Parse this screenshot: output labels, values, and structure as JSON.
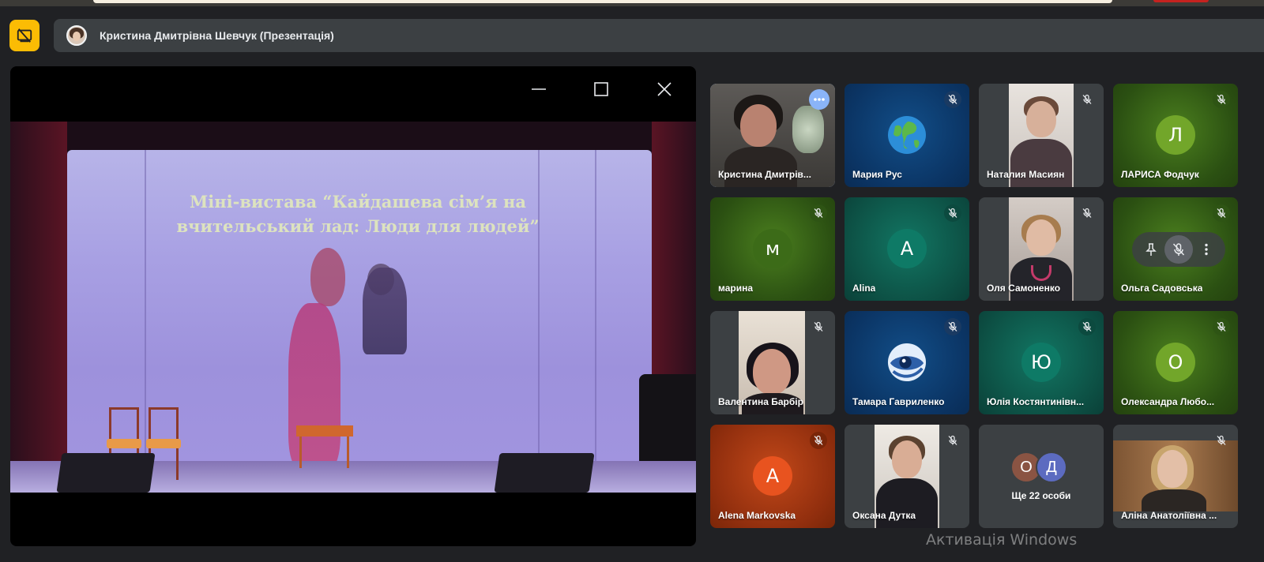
{
  "presentation_bar": {
    "title": "Кристина Дмитрівна Шевчук (Презентація)",
    "present_icon": "stop-presenting-icon"
  },
  "stage": {
    "slide_text_line1": "Міні-вистава “Кайдашева сім’я на",
    "slide_text_line2": "вчительський лад: Люди для людей”",
    "controls": [
      "minimize-icon",
      "maximize-icon",
      "close-icon"
    ]
  },
  "participants": [
    {
      "name": "Кристина Дмитрів...",
      "type": "video",
      "mic": "more",
      "active": true
    },
    {
      "name": "Мария Рус",
      "type": "globe",
      "mic": "muted"
    },
    {
      "name": "Наталия Масиян",
      "type": "video",
      "mic": "muted"
    },
    {
      "name": "ЛАРИСА Фодчук",
      "type": "letter",
      "letter": "Л",
      "mic": "muted"
    },
    {
      "name": "марина",
      "type": "letter",
      "letter": "м",
      "mic": "muted"
    },
    {
      "name": "Alina",
      "type": "letter",
      "letter": "A",
      "mic": "muted"
    },
    {
      "name": "Оля Самоненко",
      "type": "video",
      "mic": "muted"
    },
    {
      "name": "Ольга Садовська",
      "type": "letter",
      "letter": "",
      "mic": "muted",
      "hover": true
    },
    {
      "name": "Валентина Барбір",
      "type": "video",
      "mic": "muted"
    },
    {
      "name": "Тамара Гавриленко",
      "type": "eye",
      "mic": "muted"
    },
    {
      "name": "Юлія Костянтинівн...",
      "type": "letter",
      "letter": "Ю",
      "mic": "muted"
    },
    {
      "name": "Олександра Любо...",
      "type": "letter",
      "letter": "О",
      "mic": "muted"
    },
    {
      "name": "Alena Markovska",
      "type": "letter",
      "letter": "A",
      "mic": "muted"
    },
    {
      "name": "Оксана Дутка",
      "type": "video",
      "mic": "muted"
    },
    {
      "name": "Ще 22 особи",
      "type": "more",
      "letters": [
        "О",
        "Д"
      ]
    },
    {
      "name": "Аліна Анатоліївна ...",
      "type": "video",
      "mic": "muted"
    }
  ],
  "colors": {
    "present_button": "#fbbc04",
    "active_outline": "#a8c7fa",
    "muted_icon": "#e8eaed"
  },
  "watermark": "Активація Windows"
}
